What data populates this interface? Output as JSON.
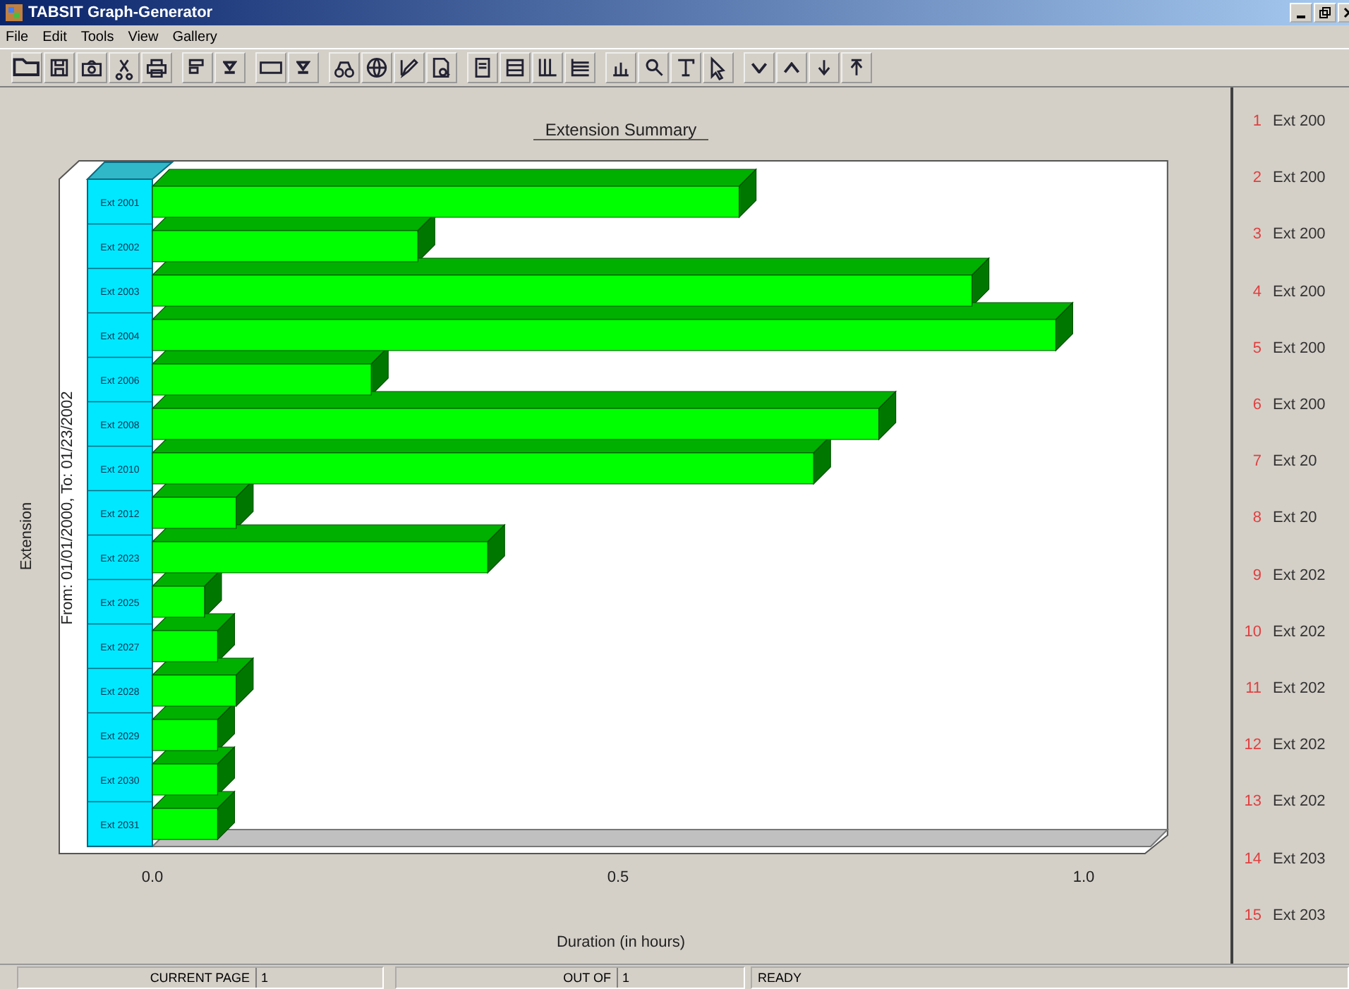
{
  "window": {
    "title": "TABSIT Graph-Generator"
  },
  "menu": [
    "File",
    "Edit",
    "Tools",
    "View",
    "Gallery"
  ],
  "chart": {
    "subtitle": "From: 01/01/2000,  To: 01/23/2002",
    "chart_data": {
      "type": "bar",
      "orientation": "horizontal",
      "title": "Extension Summary",
      "xlabel": "Duration (in hours)",
      "ylabel": "Extension",
      "categories": [
        "Ext 2001",
        "Ext 2002",
        "Ext 2003",
        "Ext 2004",
        "Ext 2006",
        "Ext 2008",
        "Ext 2010",
        "Ext 2012",
        "Ext 2023",
        "Ext 2025",
        "Ext 2027",
        "Ext 2028",
        "Ext 2029",
        "Ext 2030",
        "Ext 2031"
      ],
      "values": [
        0.63,
        0.285,
        0.88,
        0.97,
        0.235,
        0.78,
        0.71,
        0.09,
        0.36,
        0.056,
        0.07,
        0.09,
        0.07,
        0.07,
        0.07
      ],
      "xlim": [
        0,
        1.09
      ],
      "xticks": [
        {
          "value": 0,
          "label": "0.0"
        },
        {
          "value": 0.5,
          "label": "0.5"
        },
        {
          "value": 1,
          "label": "1.0"
        }
      ]
    }
  },
  "legend": [
    {
      "number": "1",
      "label": "Ext 200"
    },
    {
      "number": "2",
      "label": "Ext 200"
    },
    {
      "number": "3",
      "label": "Ext 200"
    },
    {
      "number": "4",
      "label": "Ext 200"
    },
    {
      "number": "5",
      "label": "Ext 200"
    },
    {
      "number": "6",
      "label": "Ext 200"
    },
    {
      "number": "7",
      "label": "Ext 20"
    },
    {
      "number": "8",
      "label": "Ext 20"
    },
    {
      "number": "9",
      "label": "Ext 202"
    },
    {
      "number": "10",
      "label": "Ext 202"
    },
    {
      "number": "11",
      "label": "Ext 202"
    },
    {
      "number": "12",
      "label": "Ext 202"
    },
    {
      "number": "13",
      "label": "Ext 202"
    },
    {
      "number": "14",
      "label": "Ext 203"
    },
    {
      "number": "15",
      "label": "Ext 203"
    }
  ],
  "status_bar": {
    "current_page_label": "CURRENT PAGE",
    "current_page": "1",
    "out_of_label": "OUT OF",
    "total_pages": "1",
    "status": "READY"
  }
}
